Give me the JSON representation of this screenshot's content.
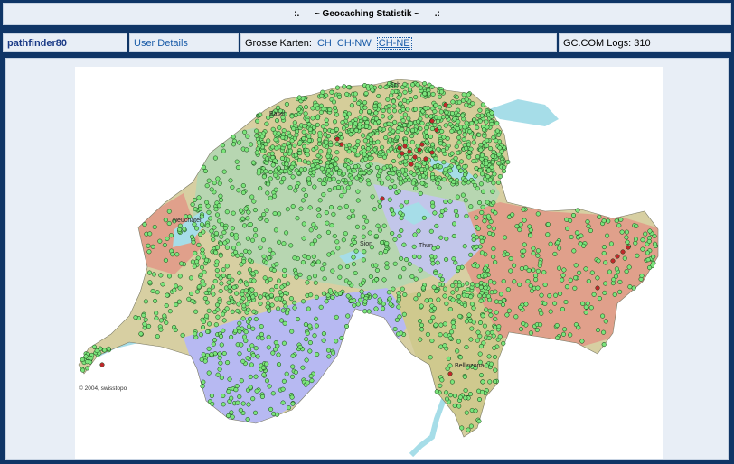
{
  "header": {
    "title": ":.      ~ Geocaching Statistik ~      .:"
  },
  "infobar": {
    "username": "pathfinder80",
    "user_details_link": "User Details",
    "maps_label": "Grosse Karten:",
    "map_links": [
      "CH",
      "CH-NW",
      "CH-NE"
    ],
    "selected_map": "CH-NE",
    "logs_label": "GC.COM Logs: 310"
  },
  "map": {
    "city_labels": [
      "Basel",
      "Sch",
      "Neuchâtel",
      "Thun",
      "Sion",
      "Bellinzona"
    ],
    "credit": "© 2004, swisstopo",
    "colors": {
      "water": "#a6dde8",
      "cache_found": "#7be47b",
      "cache_special": "#c0282b",
      "cache_outline": "#103a10",
      "region_tan": "#d7cfa2",
      "region_green": "#b7d6b1",
      "region_blue": "#b7b9f2",
      "region_salmon": "#e0a08b",
      "region_olive": "#cfc98e"
    }
  }
}
